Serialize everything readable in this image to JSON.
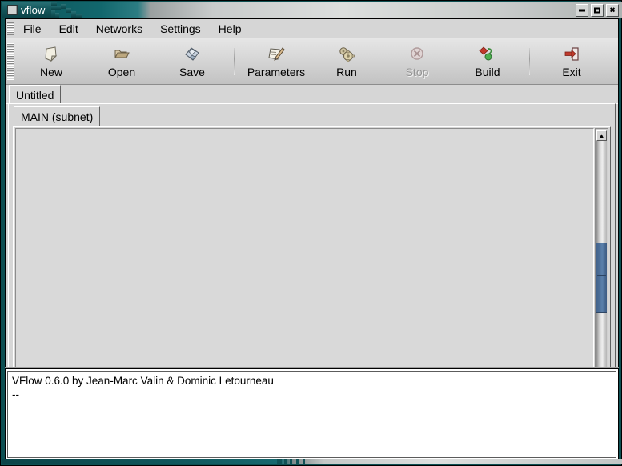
{
  "window": {
    "title": "vflow",
    "icon": "window-menu-icon",
    "controls": [
      {
        "name": "minimize-button",
        "glyph": ""
      },
      {
        "name": "maximize-button",
        "glyph": ""
      },
      {
        "name": "close-button",
        "glyph": "✖"
      }
    ]
  },
  "menubar": {
    "items": [
      {
        "mnemonic": "F",
        "rest": "ile"
      },
      {
        "mnemonic": "E",
        "rest": "dit"
      },
      {
        "mnemonic": "N",
        "rest": "etworks"
      },
      {
        "mnemonic": "S",
        "rest": "ettings"
      },
      {
        "mnemonic": "H",
        "rest": "elp"
      }
    ]
  },
  "toolbar": {
    "buttons": [
      {
        "label": "New",
        "icon": "new-document-icon",
        "enabled": true
      },
      {
        "label": "Open",
        "icon": "open-folder-icon",
        "enabled": true
      },
      {
        "label": "Save",
        "icon": "save-floppy-icon",
        "enabled": true
      },
      {
        "label": "Parameters",
        "icon": "parameters-pencil-icon",
        "enabled": true
      },
      {
        "label": "Run",
        "icon": "run-gears-icon",
        "enabled": true
      },
      {
        "label": "Stop",
        "icon": "stop-circle-icon",
        "enabled": false
      },
      {
        "label": "Build",
        "icon": "build-shapes-icon",
        "enabled": true
      },
      {
        "label": "Exit",
        "icon": "exit-door-icon",
        "enabled": true
      }
    ]
  },
  "notebook": {
    "document_tab": "Untitled",
    "subnet_tab": "MAIN (subnet)"
  },
  "canvas": {
    "background": "#d9d9d9",
    "vscroll": {
      "name": "vertical-scrollbar",
      "up": "▲",
      "down": "▼"
    },
    "hscroll": {
      "name": "horizontal-scrollbar",
      "left": "◀",
      "right": "▶"
    }
  },
  "log": {
    "lines": [
      "VFlow 0.6.0 by Jean-Marc Valin & Dominic Letourneau",
      "--"
    ]
  },
  "colors": {
    "titlebar_teal": "#0d5358",
    "frame_teal": "#0d4f52",
    "face": "#d6d6d6",
    "canvas": "#d9d9d9",
    "scroll_thumb": "#4b6d9a"
  }
}
